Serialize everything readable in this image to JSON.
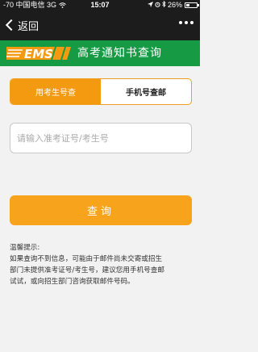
{
  "status_bar": {
    "carrier": "-70 中国电信",
    "network": "3G",
    "time": "15:07",
    "battery_text": "26%",
    "battery_level": 0.26
  },
  "nav": {
    "back_label": "返回"
  },
  "banner": {
    "logo_text": "EMS",
    "title": "高考通知书查询"
  },
  "tabs": [
    {
      "label": "用考生号查",
      "active": true
    },
    {
      "label": "手机号查邮",
      "active": false
    }
  ],
  "search": {
    "placeholder": "请输入准考证号/考生号",
    "value": ""
  },
  "query_button": {
    "label": "查询"
  },
  "tips": {
    "heading": "温馨提示:",
    "line1": "如果查询不到信息，可能由于邮件尚未交寄或招生",
    "line2": "部门未提供准考证号/考生号，建议您用手机号查邮",
    "line3": "试试，或向招生部门咨询获取邮件号码。"
  },
  "colors": {
    "banner_green": "#169a44",
    "accent_orange": "#f7a31c",
    "nav_dark": "#1c1c1c"
  }
}
